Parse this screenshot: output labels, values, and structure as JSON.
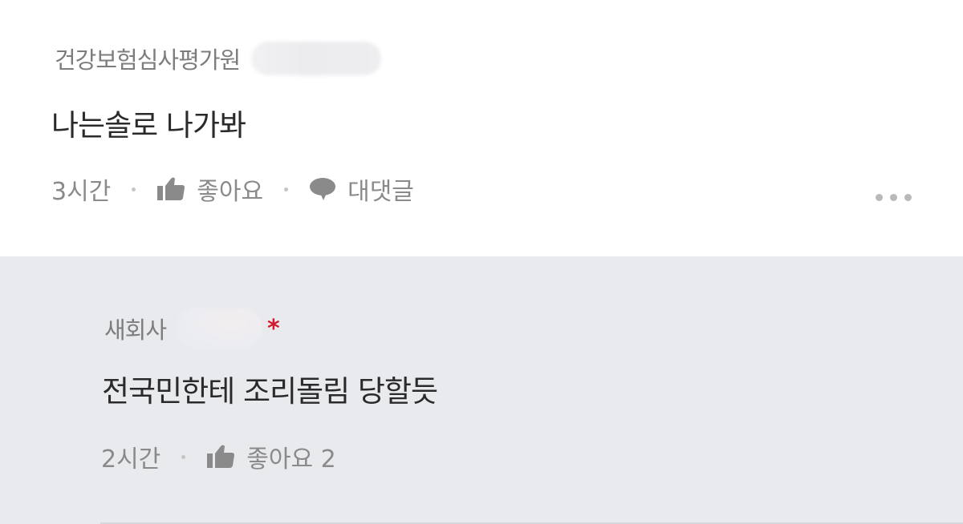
{
  "comment": {
    "author": "건강보험심사평가원",
    "text": "나는솔로 나가봐",
    "time": "3시간",
    "like_label": "좋아요",
    "reply_label": "대댓글",
    "icons": {
      "like": "thumbs-up-icon",
      "reply": "speech-bubble-icon",
      "more": "more-dots-icon"
    }
  },
  "reply": {
    "author": "새회사",
    "badge": "*",
    "text": "전국민한테 조리돌림 당할듯",
    "time": "2시간",
    "like_label": "좋아요 2"
  },
  "colors": {
    "reply_bg": "#e9eaee",
    "badge_red": "#d31a2c",
    "text_gray": "#8a8a8a"
  }
}
